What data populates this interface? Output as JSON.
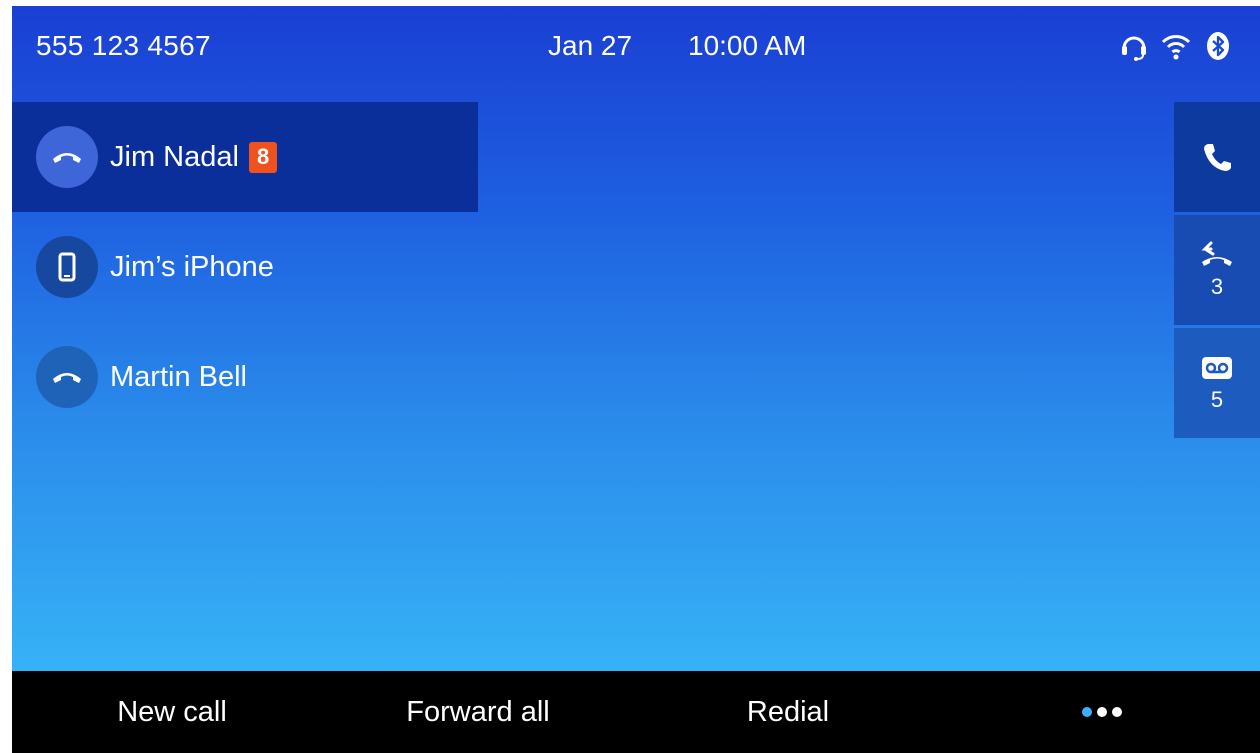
{
  "status": {
    "phone_number": "555 123 4567",
    "date": "Jan 27",
    "time": "10:00 AM",
    "icons": [
      "headset-icon",
      "wifi-icon",
      "bluetooth-icon"
    ]
  },
  "lines": [
    {
      "name": "Jim Nadal",
      "badge": "8",
      "icon": "handset-icon",
      "selected": true
    },
    {
      "name": "Jim’s iPhone",
      "badge": "",
      "icon": "mobile-phone-icon",
      "selected": false
    },
    {
      "name": "Martin Bell",
      "badge": "",
      "icon": "handset-icon",
      "selected": false
    }
  ],
  "side_tabs": [
    {
      "icon": "phone-icon",
      "count": ""
    },
    {
      "icon": "missed-call-icon",
      "count": "3"
    },
    {
      "icon": "voicemail-icon",
      "count": "5"
    }
  ],
  "softkeys": {
    "new_call": "New call",
    "forward_all": "Forward all",
    "redial": "Redial",
    "more_icon": "more-dots-icon"
  },
  "colors": {
    "badge": "#f0521d",
    "selected_row": "#0b2f9a",
    "active_dot": "#3cb0ff",
    "softkey_bar": "#000000"
  }
}
